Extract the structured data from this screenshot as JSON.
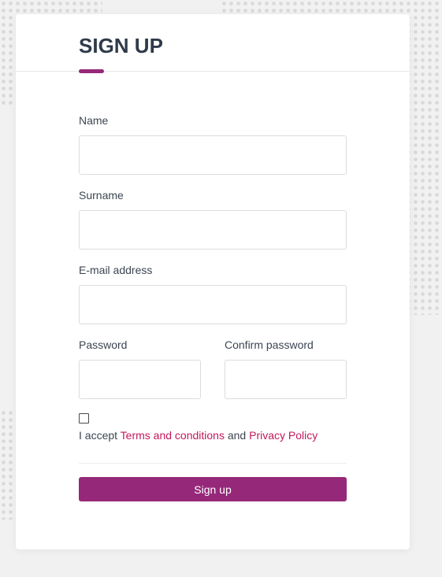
{
  "form": {
    "title": "SIGN UP",
    "fields": {
      "name": {
        "label": "Name",
        "value": "",
        "placeholder": ""
      },
      "surname": {
        "label": "Surname",
        "value": "",
        "placeholder": ""
      },
      "email": {
        "label": "E-mail address",
        "value": "",
        "placeholder": ""
      },
      "password": {
        "label": "Password",
        "value": "",
        "placeholder": ""
      },
      "confirm_password": {
        "label": "Confirm password",
        "value": "",
        "placeholder": ""
      }
    },
    "terms": {
      "checked": false,
      "prefix": "I accept ",
      "terms_link": "Terms and conditions",
      "middle": " and ",
      "privacy_link": "Privacy Policy"
    },
    "submit_label": "Sign up"
  },
  "colors": {
    "accent": "#962879",
    "link": "#c2185b",
    "text": "#2f3a4a",
    "background": "#f1f1f1"
  }
}
